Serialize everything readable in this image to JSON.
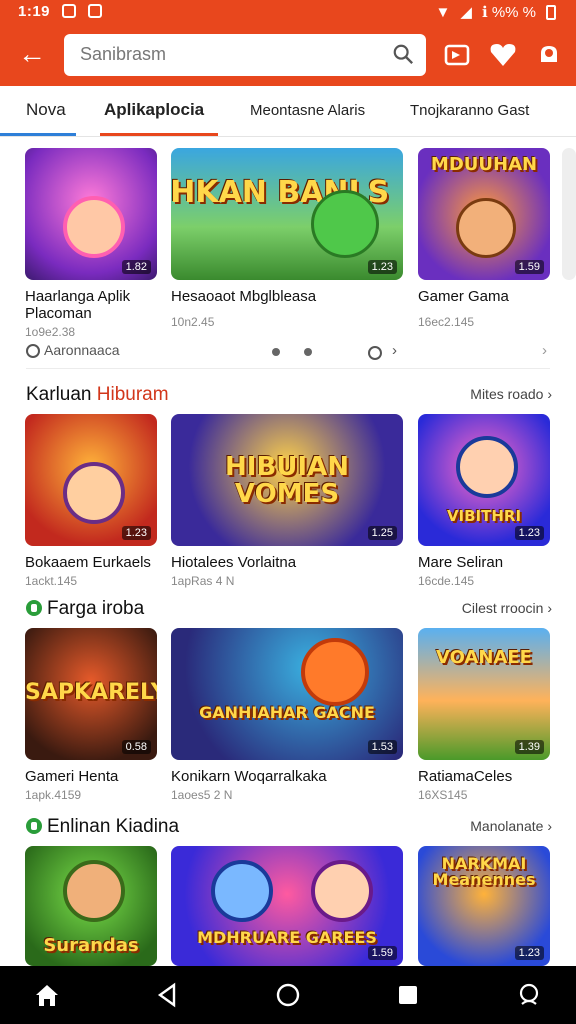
{
  "status": {
    "time": "1:19",
    "right_text": "ℹ %% %"
  },
  "app_bar": {
    "back_icon": "arrow-left-icon",
    "search": {
      "placeholder": "Sanibrasm"
    }
  },
  "tabs": [
    {
      "label": "Nova"
    },
    {
      "label": "Aplikaplocia"
    },
    {
      "label": "Meontasne Alaris"
    },
    {
      "label": "Tnojkaranno Gast"
    }
  ],
  "featured": {
    "cards": [
      {
        "title": "",
        "name": "Haarlanga Aplik",
        "name2": "Placoman",
        "meta": "1o9e2.38",
        "badge": "1.82"
      },
      {
        "title": "OHKAN BANLS",
        "name": "Hesaoaot Mbglbleasa",
        "name2": "",
        "meta": "10n2.45",
        "badge": "1.23"
      },
      {
        "title": "MDUUHAN",
        "name": "Gamer Gama",
        "name2": "",
        "meta": "16ec2.145",
        "badge": "1.59"
      }
    ],
    "more_link": "Aaronnaaca"
  },
  "sections": [
    {
      "title_plain": "Karluan ",
      "title_accent": "Hiburam",
      "link": "Mites roado",
      "cards": [
        {
          "title": "",
          "name": "Bokaaem Eurkaels",
          "meta": "1ackt.145",
          "badge": "1.23"
        },
        {
          "title": "HIBUIAN VOMES",
          "name": "Hiotalees Vorlaitna",
          "meta": "1apRas 4 N",
          "badge": "1.25"
        },
        {
          "title": "VIBITHRI",
          "name": "Mare Seliran",
          "meta": "16cde.145",
          "badge": "1.23"
        }
      ]
    },
    {
      "title_plain": "Farga iroba",
      "title_accent": "",
      "link": "Cilest rroocin",
      "cards": [
        {
          "title": "SAPKARELY",
          "name": "Gameri Henta",
          "meta": "1apk.4159",
          "badge": "0.58"
        },
        {
          "title": "GANHIAHAR GACNE",
          "name": "Konikarn Woqarralkaka",
          "meta": "1aoes5 2 N",
          "badge": "1.53"
        },
        {
          "title": "VOANAEE",
          "name": "RatiamaCeles",
          "meta": "16XS145",
          "badge": "1.39"
        }
      ]
    },
    {
      "title_plain": "Enlinan Kiadina",
      "title_accent": "",
      "link": "Manolanate",
      "cards": [
        {
          "title": "Surandas",
          "badge": ""
        },
        {
          "title": "MDHRUARE GAREES",
          "badge": "1.59"
        },
        {
          "title": "NARKMAI Meanennes",
          "badge": "1.23"
        }
      ]
    }
  ],
  "nav": [
    "home-icon",
    "back-triangle-icon",
    "home-circle-icon",
    "recents-square-icon",
    "assistant-icon"
  ]
}
